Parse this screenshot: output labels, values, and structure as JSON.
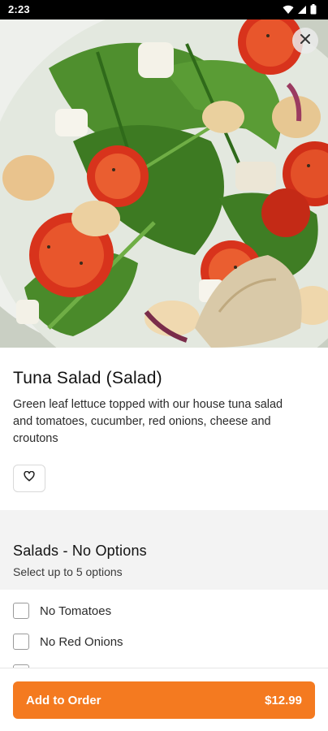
{
  "status_bar": {
    "time": "2:23",
    "icons": [
      "wifi-icon",
      "signal-icon",
      "battery-icon"
    ]
  },
  "hero": {
    "image": "tuna-salad-photo",
    "close_icon": "close-icon"
  },
  "item": {
    "title": "Tuna Salad (Salad)",
    "description": "Green leaf lettuce topped with our house tuna salad and tomatoes, cucumber, red onions, cheese and croutons",
    "favorite_icon": "heart-icon"
  },
  "options_section": {
    "title": "Salads - No Options",
    "subtitle": "Select up to 5 options",
    "options": [
      {
        "label": "No Tomatoes",
        "checked": false
      },
      {
        "label": "No Red Onions",
        "checked": false
      }
    ]
  },
  "cta": {
    "label": "Add to Order",
    "price": "$12.99"
  },
  "colors": {
    "accent": "#f47a20",
    "text_primary": "#111111",
    "section_background": "#f3f3f3"
  }
}
